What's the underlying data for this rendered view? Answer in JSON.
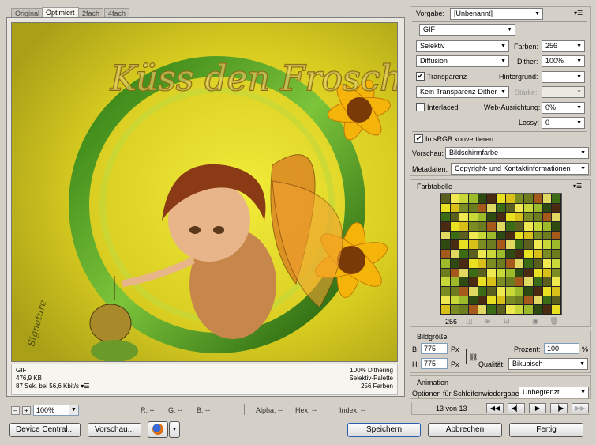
{
  "tabs": [
    "Original",
    "Optimiert",
    "2fach",
    "4fach"
  ],
  "artwork": {
    "title": "Küss den Frosch",
    "signature": "Signature"
  },
  "status": {
    "left": [
      "GIF",
      "476,9 KB",
      "87 Sek. bei 56,6 Kbit/s"
    ],
    "right": [
      "100% Dithering",
      "Selektiv-Palette",
      "256 Farben"
    ]
  },
  "toolbar": {
    "zoom_minus": "–",
    "zoom_plus": "+",
    "zoom_value": "100%",
    "r": "R: --",
    "g": "G: --",
    "b": "B: --",
    "alpha": "Alpha: --",
    "hex": "Hex: --",
    "index": "Index: --"
  },
  "buttons": {
    "device_central": "Device Central...",
    "preview": "Vorschau...",
    "save": "Speichern",
    "cancel": "Abbrechen",
    "done": "Fertig"
  },
  "settings": {
    "preset_label": "Vorgabe:",
    "preset_value": "[Unbenannt]",
    "format": "GIF",
    "reduction": "Selektiv",
    "colors_label": "Farben:",
    "colors_value": "256",
    "dither_algo": "Diffusion",
    "dither_label": "Dither:",
    "dither_value": "100%",
    "transparency_label": "Transparenz",
    "matte_label": "Hintergrund:",
    "transparency_dither": "Kein Transparenz-Dither",
    "amount_label": "Stärke:",
    "interlaced_label": "Interlaced",
    "web_snap_label": "Web-Ausrichtung:",
    "web_snap_value": "0%",
    "lossy_label": "Lossy:",
    "lossy_value": "0",
    "srgb_label": "In sRGB konvertieren",
    "preview_label": "Vorschau:",
    "preview_value": "Bildschirmfarbe",
    "metadata_label": "Metadaten:",
    "metadata_value": "Copyright- und Kontaktinformationen"
  },
  "color_table": {
    "title": "Farbtabelle",
    "count": "256",
    "colors": [
      "#5a5f1e",
      "#c8d838",
      "#2e4a10",
      "#e8e020",
      "#7b8c23",
      "#a55a1c",
      "#3b6b14",
      "#f0e850",
      "#9cba2a",
      "#4a2a10",
      "#d8c018",
      "#6e7c20",
      "#e0d860"
    ]
  },
  "image_size": {
    "title": "Bildgröße",
    "w_label": "B:",
    "w_value": "775",
    "w_unit": "Px",
    "h_label": "H:",
    "h_value": "775",
    "h_unit": "Px",
    "percent_label": "Prozent:",
    "percent_value": "100",
    "percent_unit": "%",
    "quality_label": "Qualität:",
    "quality_value": "Bikubisch"
  },
  "animation": {
    "title": "Animation",
    "loop_label": "Optionen für Schleifenwiedergabe:",
    "loop_value": "Unbegrenzt",
    "frame_counter": "13 von 13"
  }
}
